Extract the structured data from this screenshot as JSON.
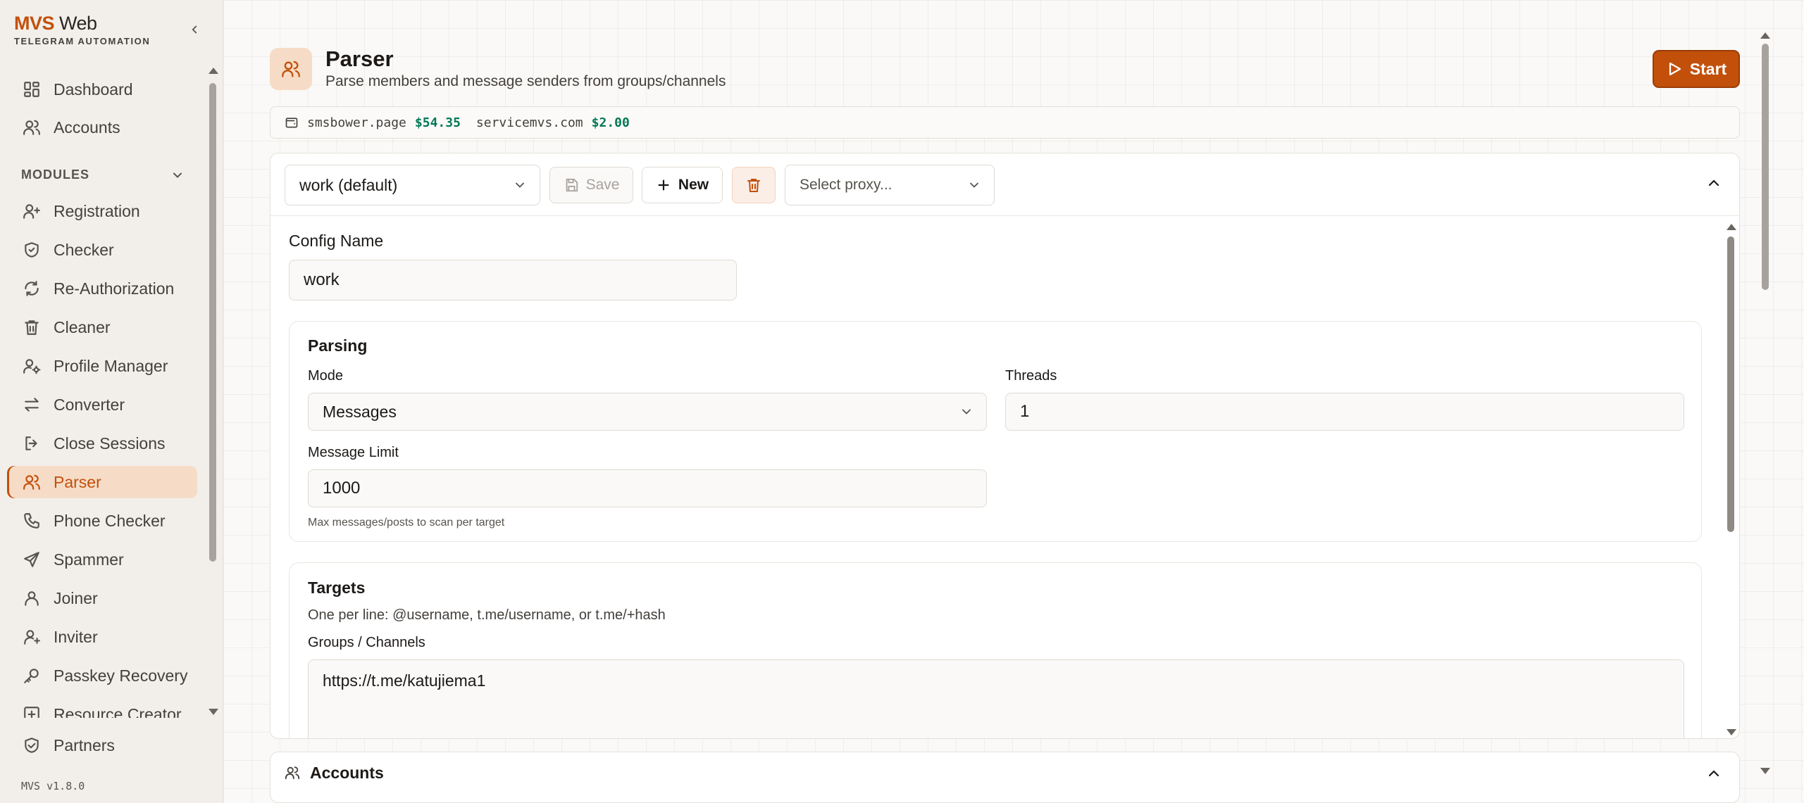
{
  "brand": {
    "name_a": "MVS",
    "name_b": "Web",
    "tagline": "TELEGRAM AUTOMATION"
  },
  "sidebar": {
    "top_items": [
      {
        "label": "Dashboard",
        "icon": "dashboard-icon"
      },
      {
        "label": "Accounts",
        "icon": "users-icon"
      }
    ],
    "section_label": "MODULES",
    "items": [
      {
        "label": "Registration",
        "icon": "user-plus-icon"
      },
      {
        "label": "Checker",
        "icon": "shield-check-icon"
      },
      {
        "label": "Re-Authorization",
        "icon": "refresh-icon"
      },
      {
        "label": "Cleaner",
        "icon": "trash-icon"
      },
      {
        "label": "Profile Manager",
        "icon": "user-cog-icon"
      },
      {
        "label": "Converter",
        "icon": "arrows-swap-icon"
      },
      {
        "label": "Close Sessions",
        "icon": "logout-icon"
      },
      {
        "label": "Parser",
        "icon": "users-icon",
        "active": true
      },
      {
        "label": "Phone Checker",
        "icon": "phone-icon"
      },
      {
        "label": "Spammer",
        "icon": "send-icon"
      },
      {
        "label": "Joiner",
        "icon": "user-icon"
      },
      {
        "label": "Inviter",
        "icon": "user-plus-icon"
      },
      {
        "label": "Passkey Recovery",
        "icon": "key-icon"
      },
      {
        "label": "Resource Creator",
        "icon": "plus-square-icon"
      }
    ],
    "partners": "Partners",
    "version": "MVS v1.8.0"
  },
  "header": {
    "title": "Parser",
    "subtitle": "Parse members and message senders from groups/channels",
    "start_label": "Start"
  },
  "balances": [
    {
      "host": "smsbower.page",
      "amount": "$54.35"
    },
    {
      "host": "servicemvs.com",
      "amount": "$2.00"
    }
  ],
  "toolbar": {
    "config_select": "work (default)",
    "save_label": "Save",
    "new_label": "New",
    "proxy_placeholder": "Select proxy..."
  },
  "form": {
    "config_name_label": "Config Name",
    "config_name_value": "work",
    "parsing": {
      "title": "Parsing",
      "mode_label": "Mode",
      "mode_value": "Messages",
      "threads_label": "Threads",
      "threads_value": "1",
      "limit_label": "Message Limit",
      "limit_value": "1000",
      "limit_hint": "Max messages/posts to scan per target"
    },
    "targets": {
      "title": "Targets",
      "description": "One per line: @username, t.me/username, or t.me/+hash",
      "groups_label": "Groups / Channels",
      "groups_value": "https://t.me/katujiema1"
    }
  },
  "accounts_section": {
    "title": "Accounts"
  },
  "colors": {
    "accent": "#c2500b",
    "accent_soft": "#f6dcc7",
    "money": "#047857"
  }
}
